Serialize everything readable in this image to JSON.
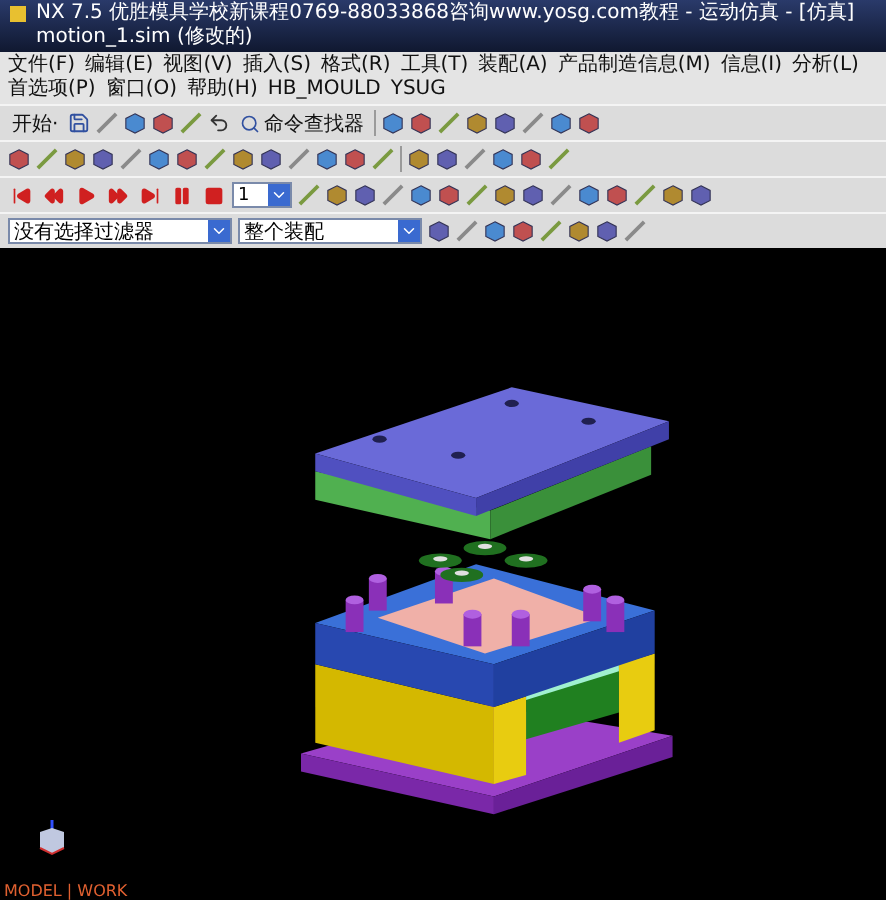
{
  "window": {
    "title": "NX 7.5 优胜模具学校新课程0769-88033868咨询www.yosg.com教程 - 运动仿真 - [仿真] motion_1.sim (修改的)"
  },
  "menu": [
    "文件(F)",
    "编辑(E)",
    "视图(V)",
    "插入(S)",
    "格式(R)",
    "工具(T)",
    "装配(A)",
    "产品制造信息(M)",
    "信息(I)",
    "分析(L)",
    "首选项(P)",
    "窗口(O)",
    "帮助(H)",
    "HB_MOULD",
    "YSUG"
  ],
  "toolbar": {
    "start_label": "开始·",
    "finder_label": "命令查找器"
  },
  "animation": {
    "step": "1"
  },
  "selection": {
    "filter": "没有选择过滤器",
    "scope": "整个装配"
  },
  "viewport": {
    "status": "MODEL | WORK"
  }
}
